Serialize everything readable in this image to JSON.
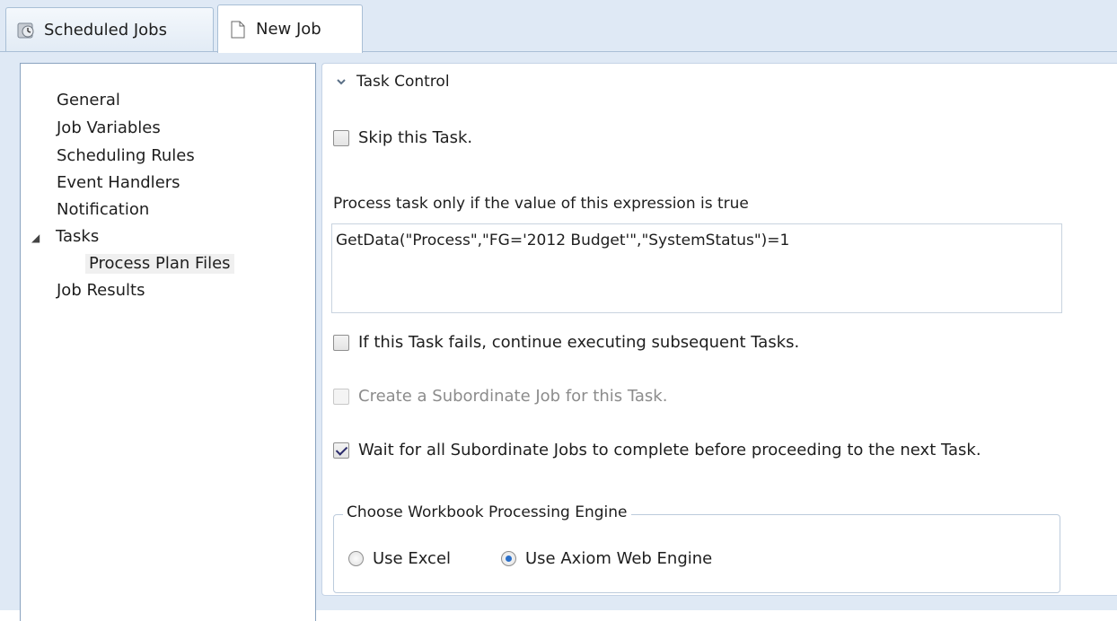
{
  "tabs": [
    {
      "label": "Scheduled Jobs",
      "icon": "scheduled-jobs-icon",
      "active": false
    },
    {
      "label": "New Job",
      "icon": "document-icon",
      "active": true
    }
  ],
  "nav": {
    "items": [
      {
        "label": "General"
      },
      {
        "label": "Job Variables"
      },
      {
        "label": "Scheduling Rules"
      },
      {
        "label": "Event Handlers"
      },
      {
        "label": "Notification"
      },
      {
        "label": "Tasks",
        "expanded": true,
        "children": [
          {
            "label": "Process Plan Files",
            "selected": true
          }
        ]
      },
      {
        "label": "Job Results"
      }
    ]
  },
  "task_control": {
    "header": "Task Control",
    "skip_task": {
      "label": "Skip this Task.",
      "checked": false
    },
    "expression_label": "Process task only if the value of this expression is true",
    "expression_value": "GetData(\"Process\",\"FG='2012 Budget'\",\"SystemStatus\")=1",
    "continue_on_fail": {
      "label": "If this Task fails, continue executing subsequent Tasks.",
      "checked": false
    },
    "create_subordinate": {
      "label": "Create a Subordinate Job for this Task.",
      "checked": false,
      "disabled": true
    },
    "wait_subordinate": {
      "label": "Wait for all Subordinate Jobs to complete before proceeding to the next Task.",
      "checked": true
    },
    "engine_group": {
      "title": "Choose Workbook Processing Engine",
      "options": [
        {
          "label": "Use Excel",
          "selected": false
        },
        {
          "label": "Use Axiom Web Engine",
          "selected": true
        }
      ]
    }
  },
  "colors": {
    "accent": "#2a6fc9",
    "background": "#dfe9f5",
    "border": "#a9bfd6"
  }
}
